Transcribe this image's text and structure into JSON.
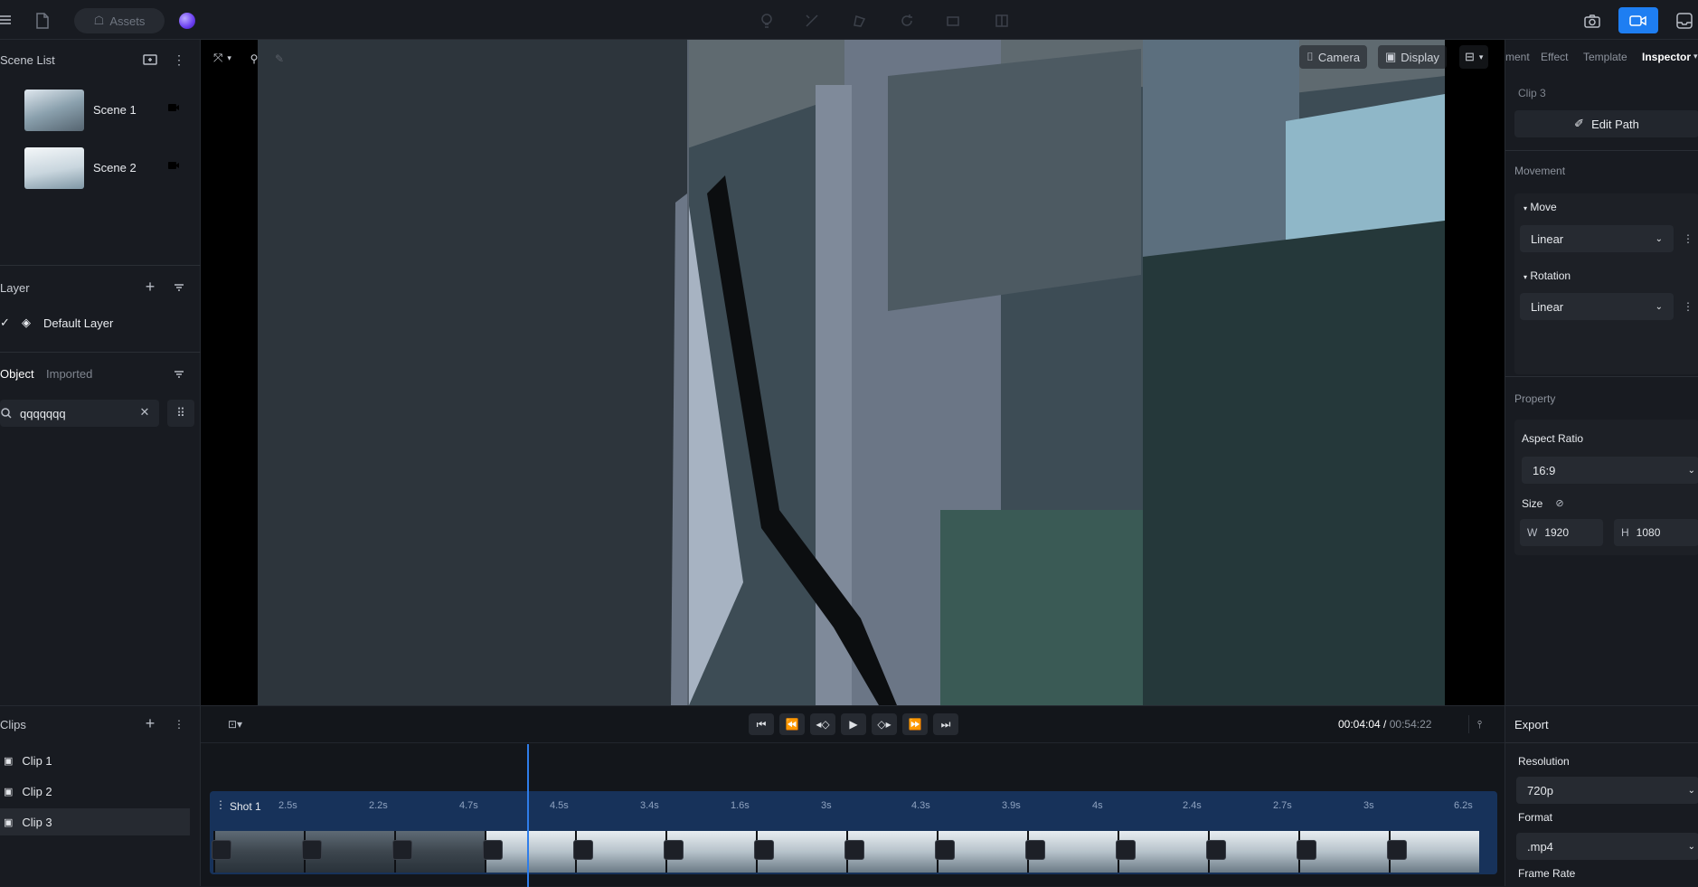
{
  "topbar": {
    "assets_label": "Assets"
  },
  "left": {
    "scene_list_title": "Scene List",
    "scenes": [
      {
        "label": "Scene 1"
      },
      {
        "label": "Scene 2"
      }
    ],
    "layer_title": "Layer",
    "layers": [
      {
        "label": "Default Layer"
      }
    ],
    "object_tabs": [
      "Object",
      "Imported"
    ],
    "search_value": "qqqqqqq"
  },
  "viewport": {
    "camera_label": "Camera",
    "display_label": "Display"
  },
  "inspector": {
    "tabs": [
      "ment",
      "Effect",
      "Template",
      "Inspector"
    ],
    "clip_name": "Clip 3",
    "edit_path_label": "Edit Path",
    "movement_title": "Movement",
    "move_label": "Move",
    "move_value": "Linear",
    "rotation_label": "Rotation",
    "rotation_value": "Linear",
    "property_title": "Property",
    "aspect_ratio_label": "Aspect Ratio",
    "aspect_ratio_value": "16:9",
    "size_label": "Size",
    "w_label": "W",
    "w_value": "1920",
    "h_label": "H",
    "h_value": "1080"
  },
  "clips": {
    "title": "Clips",
    "items": [
      {
        "label": "Clip 1"
      },
      {
        "label": "Clip 2"
      },
      {
        "label": "Clip 3"
      }
    ]
  },
  "timeline": {
    "time_current": "00:04:04",
    "time_sep": " / ",
    "time_total": "00:54:22",
    "shot_label": "Shot 1",
    "durations": [
      "2.5s",
      "2.2s",
      "4.7s",
      "4.5s",
      "3.4s",
      "1.6s",
      "3s",
      "4.3s",
      "3.9s",
      "4s",
      "2.4s",
      "2.7s",
      "3s",
      "6.2s"
    ]
  },
  "export": {
    "title": "Export",
    "resolution_label": "Resolution",
    "resolution_value": "720p",
    "format_label": "Format",
    "format_value": ".mp4",
    "frame_rate_label": "Frame Rate"
  },
  "colors": {
    "accent": "#1e7ef2",
    "shot_bg": "#17325a",
    "playhead": "#2f7de8"
  }
}
